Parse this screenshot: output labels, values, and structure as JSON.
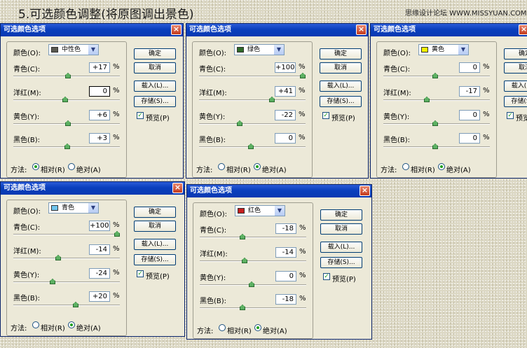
{
  "heading": "5.可选颜色调整(将原图调出景色)",
  "site": "思缘设计论坛 WWW.MISSYUAN.COM",
  "dialog_title": "可选颜色选项",
  "close_glyph": "×",
  "labels": {
    "colors": "颜色(O):",
    "cyan": "青色(C):",
    "magenta": "洋红(M):",
    "yellow": "黄色(Y):",
    "black": "黑色(B):",
    "percent": "%",
    "method": "方法:",
    "relative": "相对(R)",
    "absolute": "绝对(A)",
    "preview": "预览(P)"
  },
  "buttons": {
    "ok": "确定",
    "cancel": "取消",
    "load": "载入(L)...",
    "save": "存储(S)..."
  },
  "dialogs": [
    {
      "color_name": "中性色",
      "swatch": "#5a5a52",
      "cyan": "+17",
      "magenta": "0",
      "yellow": "+6",
      "black": "+3",
      "method": "relative",
      "magenta_selected": true,
      "slider": [
        0.53,
        0.5,
        0.53,
        0.52
      ]
    },
    {
      "color_name": "绿色",
      "swatch": "#2f6a2a",
      "cyan": "+100",
      "magenta": "+41",
      "yellow": "-22",
      "black": "0",
      "method": "absolute",
      "magenta_selected": false,
      "slider": [
        1.0,
        0.7,
        0.39,
        0.5
      ]
    },
    {
      "color_name": "黄色",
      "swatch": "#f3f300",
      "cyan": "0",
      "magenta": "-17",
      "yellow": "0",
      "black": "0",
      "method": "absolute",
      "magenta_selected": false,
      "slider": [
        0.5,
        0.42,
        0.5,
        0.5
      ]
    },
    {
      "color_name": "青色",
      "swatch": "#6fc4ee",
      "cyan": "+100",
      "magenta": "-14",
      "yellow": "-24",
      "black": "+20",
      "method": "absolute",
      "magenta_selected": false,
      "slider": [
        1.0,
        0.43,
        0.38,
        0.6
      ]
    },
    {
      "color_name": "红色",
      "swatch": "#c81e1e",
      "cyan": "-18",
      "magenta": "-14",
      "yellow": "0",
      "black": "-18",
      "method": "absolute",
      "magenta_selected": false,
      "slider": [
        0.41,
        0.43,
        0.5,
        0.41
      ]
    }
  ]
}
